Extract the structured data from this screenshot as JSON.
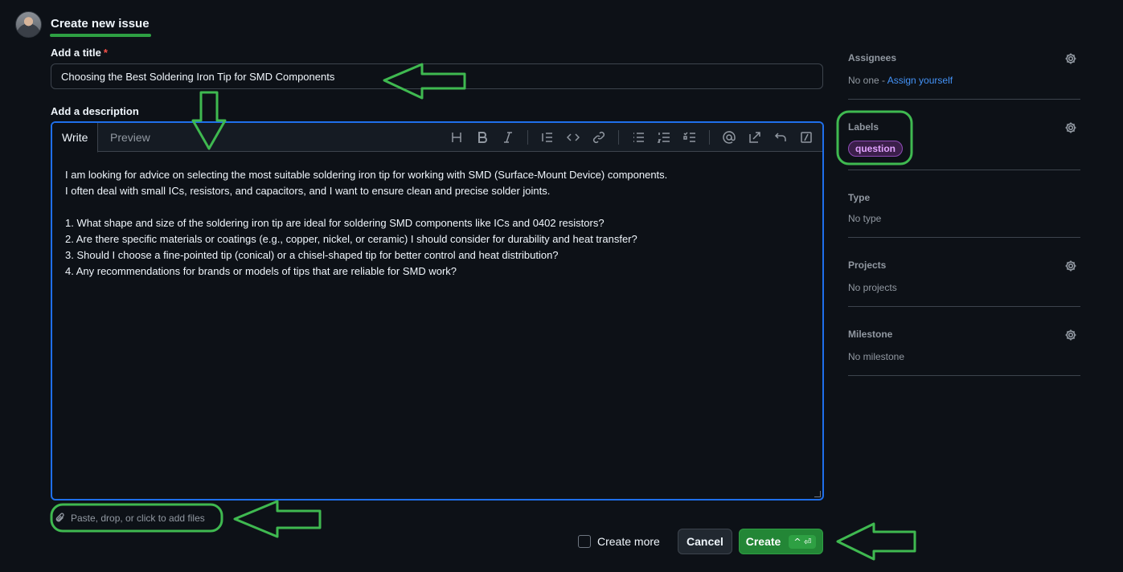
{
  "header": {
    "title": "Create new issue"
  },
  "form": {
    "title_label": "Add a title",
    "required_mark": "*",
    "title_value": "Choosing the Best Soldering Iron Tip for SMD Components",
    "description_label": "Add a description",
    "tabs": {
      "write": "Write",
      "preview": "Preview"
    },
    "toolbar_icons": [
      "heading-icon",
      "bold-icon",
      "italic-icon",
      "quote-icon",
      "code-icon",
      "link-icon",
      "bulleted-list-icon",
      "numbered-list-icon",
      "task-list-icon",
      "mention-icon",
      "cross-reference-icon",
      "undo-icon",
      "slash-command-icon"
    ],
    "description_lines": [
      "I am looking for advice on selecting the most suitable soldering iron tip for working with SMD (Surface-Mount Device) components.",
      "I often deal with small ICs, resistors, and capacitors, and I want to ensure clean and precise solder joints.",
      "",
      "1. What shape and size of the soldering iron tip are ideal for soldering SMD components like ICs and 0402 resistors?",
      "2. Are there specific materials or coatings (e.g., copper, nickel, or ceramic) I should consider for durability and heat transfer?",
      "3. Should I choose a fine-pointed tip (conical) or a chisel-shaped tip for better control and heat distribution?",
      "4. Any recommendations for brands or models of tips that are reliable for SMD work?"
    ],
    "attach_text": "Paste, drop, or click to add files"
  },
  "actions": {
    "create_more": "Create more",
    "cancel": "Cancel",
    "create": "Create",
    "create_shortcut": "^ ⏎"
  },
  "sidebar": {
    "assignees": {
      "title": "Assignees",
      "value": "No one - ",
      "link": "Assign yourself"
    },
    "labels": {
      "title": "Labels",
      "label": "question"
    },
    "type": {
      "title": "Type",
      "value": "No type"
    },
    "projects": {
      "title": "Projects",
      "value": "No projects"
    },
    "milestone": {
      "title": "Milestone",
      "value": "No milestone"
    }
  },
  "colors": {
    "accent_green": "#2ea043",
    "focus_blue": "#1f6feb",
    "annotation_green": "#3fb950",
    "label_purple": "#8f4bb8"
  }
}
